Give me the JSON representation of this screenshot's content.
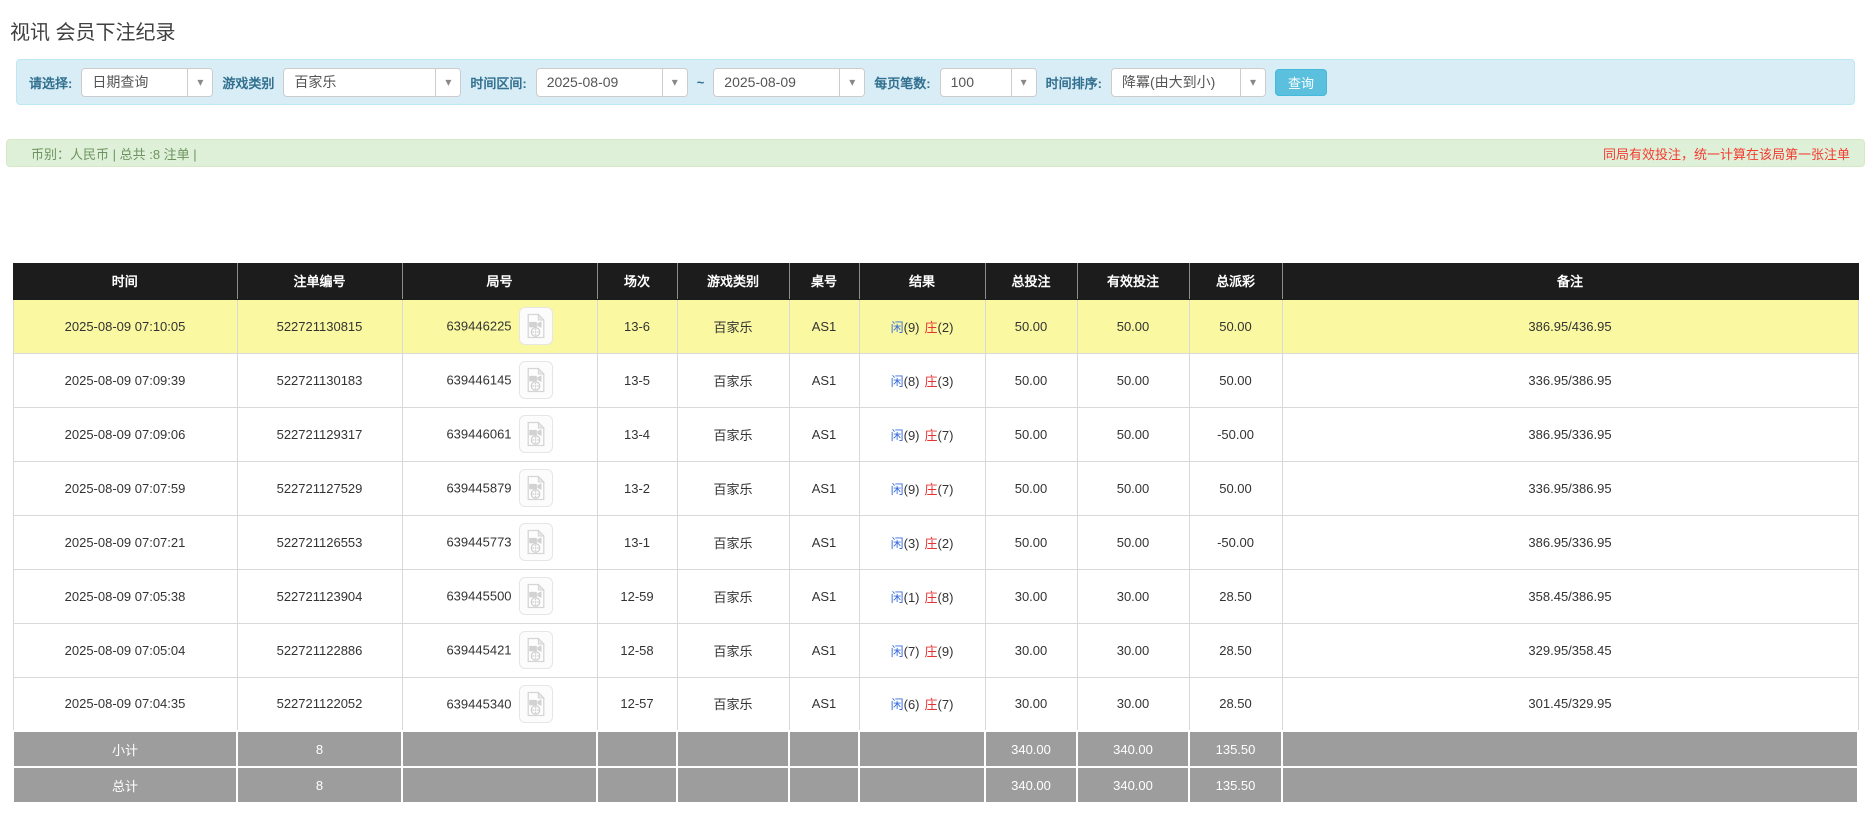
{
  "page": {
    "title": "视讯 会员下注纪录"
  },
  "icons": {
    "caret_down": "▾",
    "video_replay": "video-file-icon"
  },
  "colors": {
    "accent_blue": "#5bc0de",
    "link_blue": "#3b6fdc",
    "negative_red": "#ff2a2a",
    "banker_red": "#e53333",
    "player_blue": "#3b6fdc",
    "highlight_yellow": "#faf8a1",
    "header_black": "#1c1c1c",
    "footer_gray": "#9d9d9d",
    "summary_green_bg": "#dff0d8",
    "filter_blue_bg": "#d9edf7"
  },
  "filters": {
    "select_label": "请选择:",
    "select_value": "日期查询",
    "game_label": "游戏类别",
    "game_value": "百家乐",
    "range_label": "时间区间:",
    "date_from": "2025-08-09",
    "range_tilde": "~",
    "date_to": "2025-08-09",
    "per_page_label": "每页笔数:",
    "per_page_value": "100",
    "sort_label": "时间排序:",
    "sort_value": "降冪(由大到小)",
    "search_button": "查询"
  },
  "summary": {
    "left": "币别：人民币 | 总共 :8 注单 |",
    "right": "同局有效投注，统一计算在该局第一张注单"
  },
  "table": {
    "headers": {
      "time": "时间",
      "bet_id": "注单编号",
      "round": "局号",
      "session": "场次",
      "game": "游戏类别",
      "table_no": "桌号",
      "result": "结果",
      "total_bet": "总投注",
      "valid_bet": "有效投注",
      "payout": "总派彩",
      "note": "备注"
    },
    "rows": [
      {
        "time": "2025-08-09 07:10:05",
        "bet_id": "522721130815",
        "round_id": "639446225",
        "session": "13-6",
        "game": "百家乐",
        "table_no": "AS1",
        "result": {
          "player": "闲",
          "player_score": "(9)",
          "banker": "庄",
          "banker_score": "(2)"
        },
        "total_bet": "50.00",
        "valid_bet": "50.00",
        "payout": "50.00",
        "note": "386.95/436.95"
      },
      {
        "time": "2025-08-09 07:09:39",
        "bet_id": "522721130183",
        "round_id": "639446145",
        "session": "13-5",
        "game": "百家乐",
        "table_no": "AS1",
        "result": {
          "player": "闲",
          "player_score": "(8)",
          "banker": "庄",
          "banker_score": "(3)"
        },
        "total_bet": "50.00",
        "valid_bet": "50.00",
        "payout": "50.00",
        "note": "336.95/386.95"
      },
      {
        "time": "2025-08-09 07:09:06",
        "bet_id": "522721129317",
        "round_id": "639446061",
        "session": "13-4",
        "game": "百家乐",
        "table_no": "AS1",
        "result": {
          "player": "闲",
          "player_score": "(9)",
          "banker": "庄",
          "banker_score": "(7)"
        },
        "total_bet": "50.00",
        "valid_bet": "50.00",
        "payout": "-50.00",
        "note": "386.95/336.95"
      },
      {
        "time": "2025-08-09 07:07:59",
        "bet_id": "522721127529",
        "round_id": "639445879",
        "session": "13-2",
        "game": "百家乐",
        "table_no": "AS1",
        "result": {
          "player": "闲",
          "player_score": "(9)",
          "banker": "庄",
          "banker_score": "(7)"
        },
        "total_bet": "50.00",
        "valid_bet": "50.00",
        "payout": "50.00",
        "note": "336.95/386.95"
      },
      {
        "time": "2025-08-09 07:07:21",
        "bet_id": "522721126553",
        "round_id": "639445773",
        "session": "13-1",
        "game": "百家乐",
        "table_no": "AS1",
        "result": {
          "player": "闲",
          "player_score": "(3)",
          "banker": "庄",
          "banker_score": "(2)"
        },
        "total_bet": "50.00",
        "valid_bet": "50.00",
        "payout": "-50.00",
        "note": "386.95/336.95"
      },
      {
        "time": "2025-08-09 07:05:38",
        "bet_id": "522721123904",
        "round_id": "639445500",
        "session": "12-59",
        "game": "百家乐",
        "table_no": "AS1",
        "result": {
          "player": "闲",
          "player_score": "(1)",
          "banker": "庄",
          "banker_score": "(8)"
        },
        "total_bet": "30.00",
        "valid_bet": "30.00",
        "payout": "28.50",
        "note": "358.45/386.95"
      },
      {
        "time": "2025-08-09 07:05:04",
        "bet_id": "522721122886",
        "round_id": "639445421",
        "session": "12-58",
        "game": "百家乐",
        "table_no": "AS1",
        "result": {
          "player": "闲",
          "player_score": "(7)",
          "banker": "庄",
          "banker_score": "(9)"
        },
        "total_bet": "30.00",
        "valid_bet": "30.00",
        "payout": "28.50",
        "note": "329.95/358.45"
      },
      {
        "time": "2025-08-09 07:04:35",
        "bet_id": "522721122052",
        "round_id": "639445340",
        "session": "12-57",
        "game": "百家乐",
        "table_no": "AS1",
        "result": {
          "player": "闲",
          "player_score": "(6)",
          "banker": "庄",
          "banker_score": "(7)"
        },
        "total_bet": "30.00",
        "valid_bet": "30.00",
        "payout": "28.50",
        "note": "301.45/329.95"
      }
    ],
    "footer": [
      {
        "label": "小计",
        "count": "8",
        "total_bet": "340.00",
        "valid_bet": "340.00",
        "payout": "135.50"
      },
      {
        "label": "总计",
        "count": "8",
        "total_bet": "340.00",
        "valid_bet": "340.00",
        "payout": "135.50"
      }
    ]
  }
}
